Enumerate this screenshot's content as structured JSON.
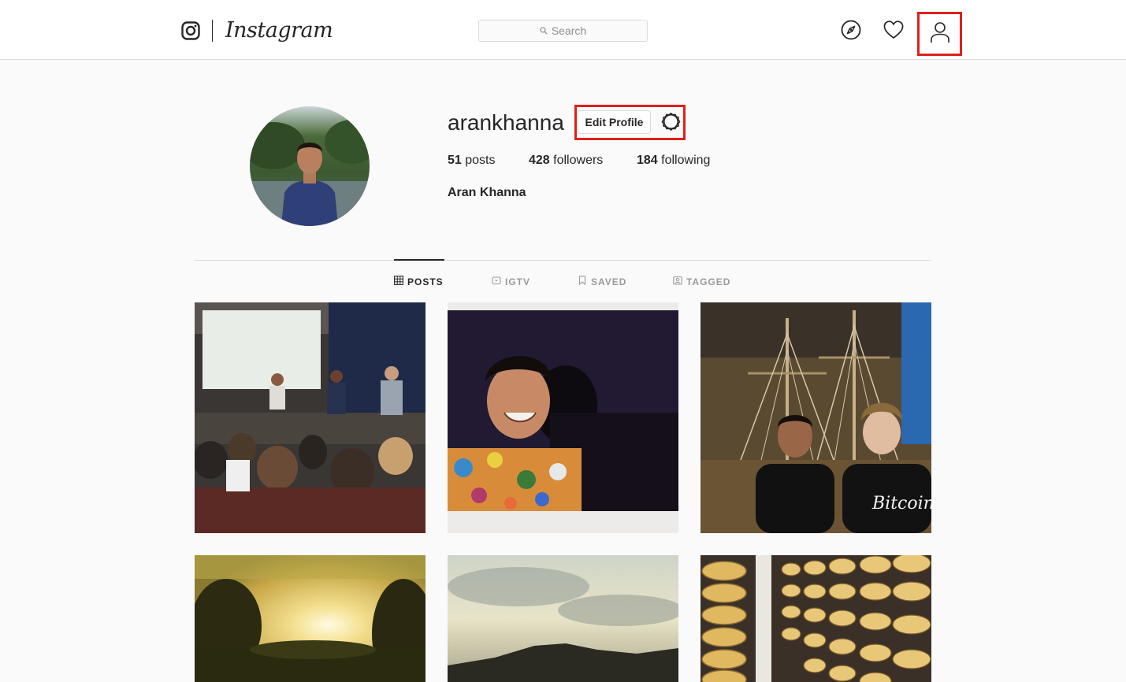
{
  "header": {
    "wordmark": "Instagram",
    "search_placeholder": "Search",
    "icons": [
      "instagram-glyph-icon",
      "search-icon",
      "compass-icon",
      "heart-icon",
      "user-icon"
    ]
  },
  "profile": {
    "username": "arankhanna",
    "edit_button_label": "Edit Profile",
    "settings_icon": "gear-icon",
    "stats": {
      "posts_count": "51",
      "posts_label": "posts",
      "followers_count": "428",
      "followers_label": "followers",
      "following_count": "184",
      "following_label": "following"
    },
    "full_name": "Aran Khanna"
  },
  "tabs": [
    {
      "label": "POSTS",
      "icon": "grid-icon",
      "active": true
    },
    {
      "label": "IGTV",
      "icon": "tv-icon",
      "active": false
    },
    {
      "label": "SAVED",
      "icon": "bookmark-icon",
      "active": false
    },
    {
      "label": "TAGGED",
      "icon": "tag-icon",
      "active": false
    }
  ],
  "colors": {
    "highlight": "#e0201c",
    "background": "#fafafa",
    "text": "#262626",
    "muted": "#999999"
  }
}
